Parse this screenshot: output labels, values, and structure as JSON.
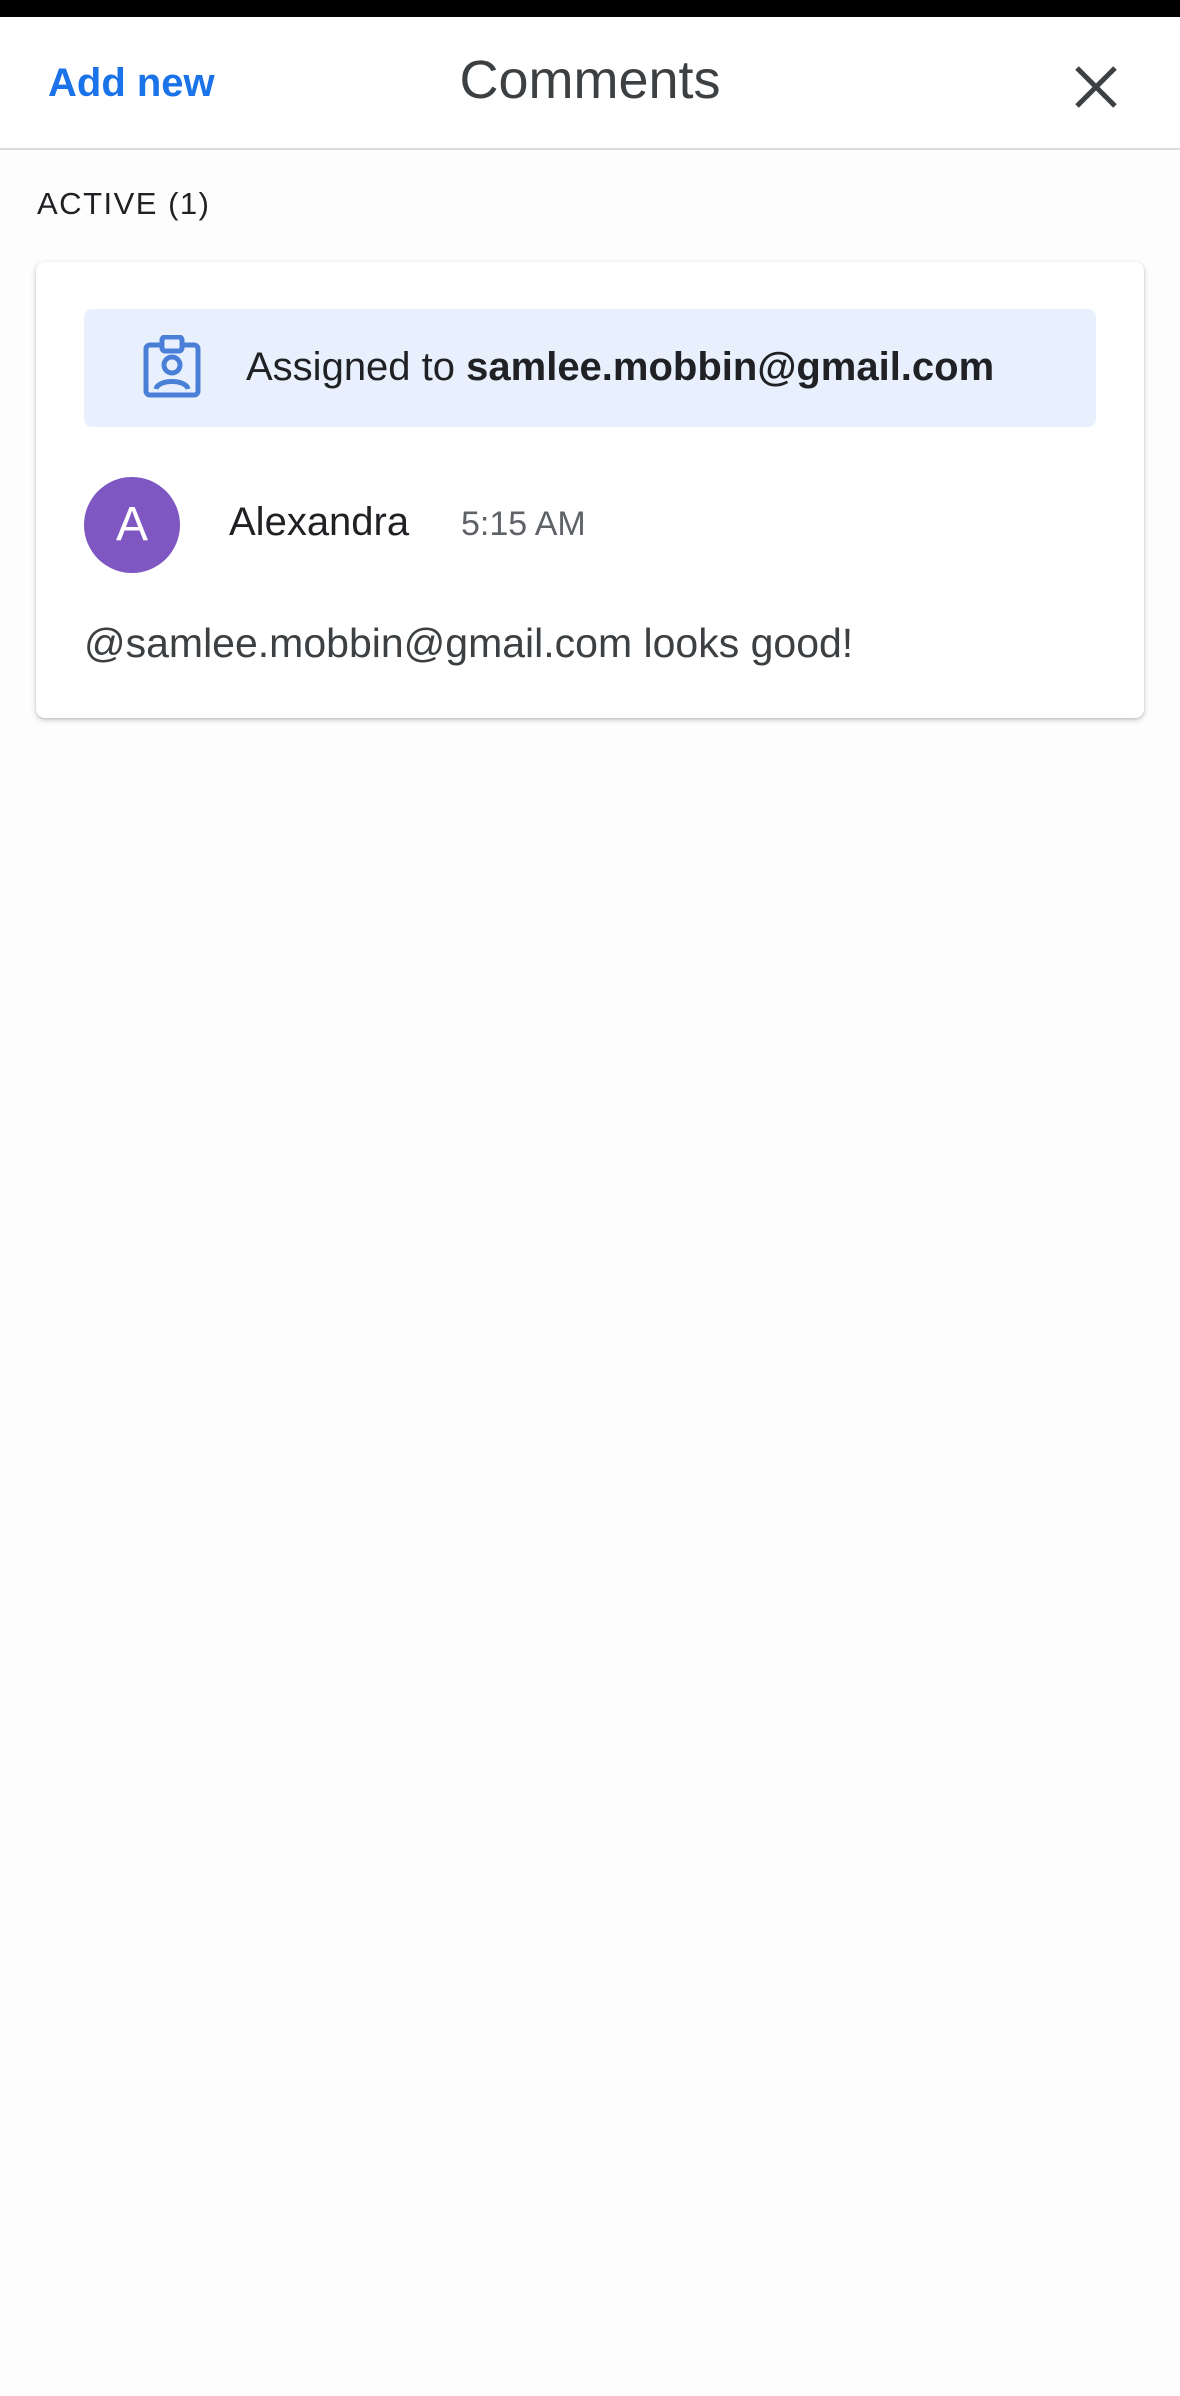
{
  "header": {
    "add_new_label": "Add new",
    "title": "Comments",
    "close_icon": "close-icon"
  },
  "section": {
    "label": "ACTIVE (1)"
  },
  "comment": {
    "assignment": {
      "icon": "assignment-ind-icon",
      "prefix": "Assigned to ",
      "assignee": "samlee.mobbin@gmail.com"
    },
    "author": {
      "initial": "A",
      "name": "Alexandra",
      "avatar_color": "#7e57c2"
    },
    "time": "5:15 AM",
    "body": "@samlee.mobbin@gmail.com looks good!"
  },
  "colors": {
    "accent": "#1a73e8",
    "banner_bg": "#e8f0fe"
  }
}
